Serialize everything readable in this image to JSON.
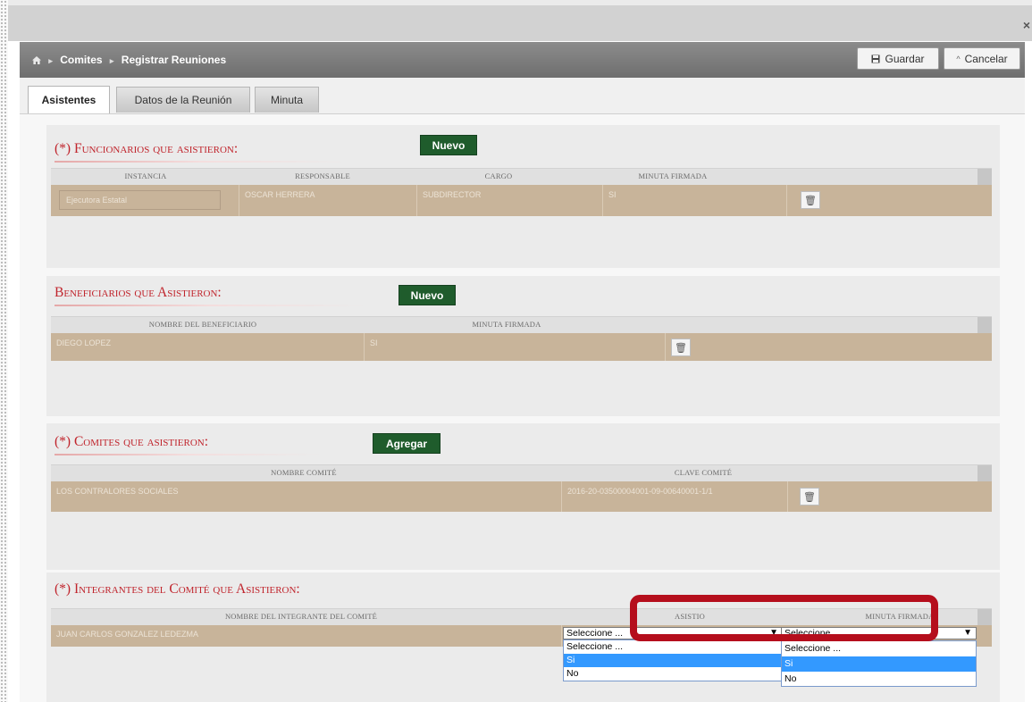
{
  "window": {
    "close_symbol": "×"
  },
  "header": {
    "breadcrumb": [
      "Comites",
      "Registrar Reuniones"
    ],
    "home_icon": "home-icon",
    "save_label": "Guardar",
    "cancel_label": "Cancelar"
  },
  "tabs": [
    {
      "label": "Asistentes",
      "active": true
    },
    {
      "label": "Datos de la Reunión",
      "active": false
    },
    {
      "label": "Minuta",
      "active": false
    }
  ],
  "funcionarios": {
    "title": "(*) Funcionarios que asistieron:",
    "button": "Nuevo",
    "columns": [
      "Instancia",
      "Responsable",
      "Cargo",
      "Minuta Firmada"
    ],
    "rows": [
      {
        "instancia": "Ejecutora Estatal",
        "responsable": "OSCAR HERRERA",
        "cargo": "SUBDIRECTOR",
        "minuta": "SI"
      }
    ]
  },
  "beneficiarios": {
    "title": "Beneficiarios que Asistieron:",
    "button": "Nuevo",
    "columns": [
      "Nombre del Beneficiario",
      "Minuta Firmada"
    ],
    "rows": [
      {
        "nombre": "DIEGO LOPEZ",
        "minuta": "SI"
      }
    ]
  },
  "comites": {
    "title": "(*) Comites que asistieron:",
    "button": "Agregar",
    "columns": [
      "Nombre Comité",
      "Clave Comité"
    ],
    "rows": [
      {
        "nombre": "LOS CONTRALORES SOCIALES",
        "clave": "2016-20-03500004001-09-00640001-1/1"
      }
    ]
  },
  "integrantes": {
    "title": "(*) Integrantes del Comité que Asistieron:",
    "columns": [
      "Nombre del Integrante del Comité",
      "Asistio",
      "Minuta Firmada"
    ],
    "rows": [
      {
        "nombre": "JUAN CARLOS GONZALEZ LEDEZMA"
      }
    ],
    "asistio_select": {
      "value": "Seleccione ...",
      "options": [
        "Seleccione ...",
        "Si",
        "No"
      ],
      "highlighted": "Si"
    },
    "minuta_select": {
      "value": "Seleccione ...",
      "options": [
        "Seleccione ...",
        "Si",
        "No"
      ],
      "highlighted": "Si"
    }
  },
  "colors": {
    "accent_red": "#c0242c",
    "row_tan": "#c8b49a",
    "button_green": "#1f5c2c",
    "highlight_box": "#b50e1c",
    "option_selected": "#3399ff"
  }
}
